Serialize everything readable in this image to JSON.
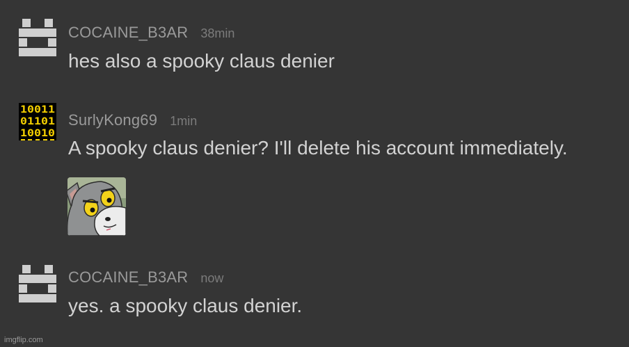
{
  "comments": [
    {
      "username": "COCAINE_B3AR",
      "time": "38min",
      "text": "hes also a spooky claus denier",
      "avatar_icon": "pixel-block-avatar-icon"
    },
    {
      "username": "SurlyKong69",
      "time": "1min",
      "text": "A spooky claus denier? I'll delete his account immediately.",
      "avatar_icon": "binary-digits-avatar-icon",
      "avatar_rows": [
        "10011",
        "01101",
        "10010"
      ],
      "attachment": "unsettled-tom-meme-image"
    },
    {
      "username": "COCAINE_B3AR",
      "time": "now",
      "text": "yes. a spooky claus denier.",
      "avatar_icon": "pixel-block-avatar-icon"
    }
  ],
  "watermark": "imgflip.com",
  "colors": {
    "background": "#353535",
    "username": "#9a9a9a",
    "timestamp": "#7c7c7c",
    "message": "#d2d2d2",
    "avatar_gray": "#cfcfcf",
    "binary_yellow": "#f5d000"
  }
}
